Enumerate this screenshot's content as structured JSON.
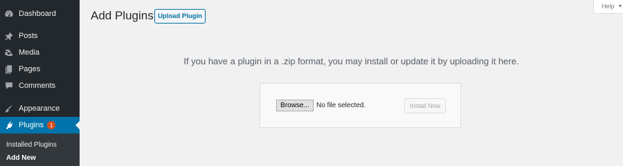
{
  "sidebar": {
    "items": [
      {
        "label": "Dashboard",
        "icon": "dashboard-icon"
      },
      {
        "label": "Posts",
        "icon": "pin-icon"
      },
      {
        "label": "Media",
        "icon": "media-icon"
      },
      {
        "label": "Pages",
        "icon": "pages-icon"
      },
      {
        "label": "Comments",
        "icon": "comment-icon"
      },
      {
        "label": "Appearance",
        "icon": "brush-icon"
      },
      {
        "label": "Plugins",
        "icon": "plug-icon",
        "badge": "1",
        "active": true
      }
    ],
    "submenu": [
      {
        "label": "Installed Plugins"
      },
      {
        "label": "Add New",
        "current": true
      }
    ]
  },
  "header": {
    "title": "Add Plugins",
    "upload_button": "Upload Plugin",
    "help_tab": "Help"
  },
  "main": {
    "description": "If you have a plugin in a .zip format, you may install or update it by uploading it here.",
    "upload_form": {
      "browse_label": "Browse...",
      "file_status": "No file selected.",
      "install_label": "Install Now",
      "install_disabled": true
    }
  },
  "colors": {
    "sidebar_bg": "#23282d",
    "active_bg": "#0073aa",
    "badge_bg": "#d54e21",
    "page_bg": "#f1f1f1"
  }
}
